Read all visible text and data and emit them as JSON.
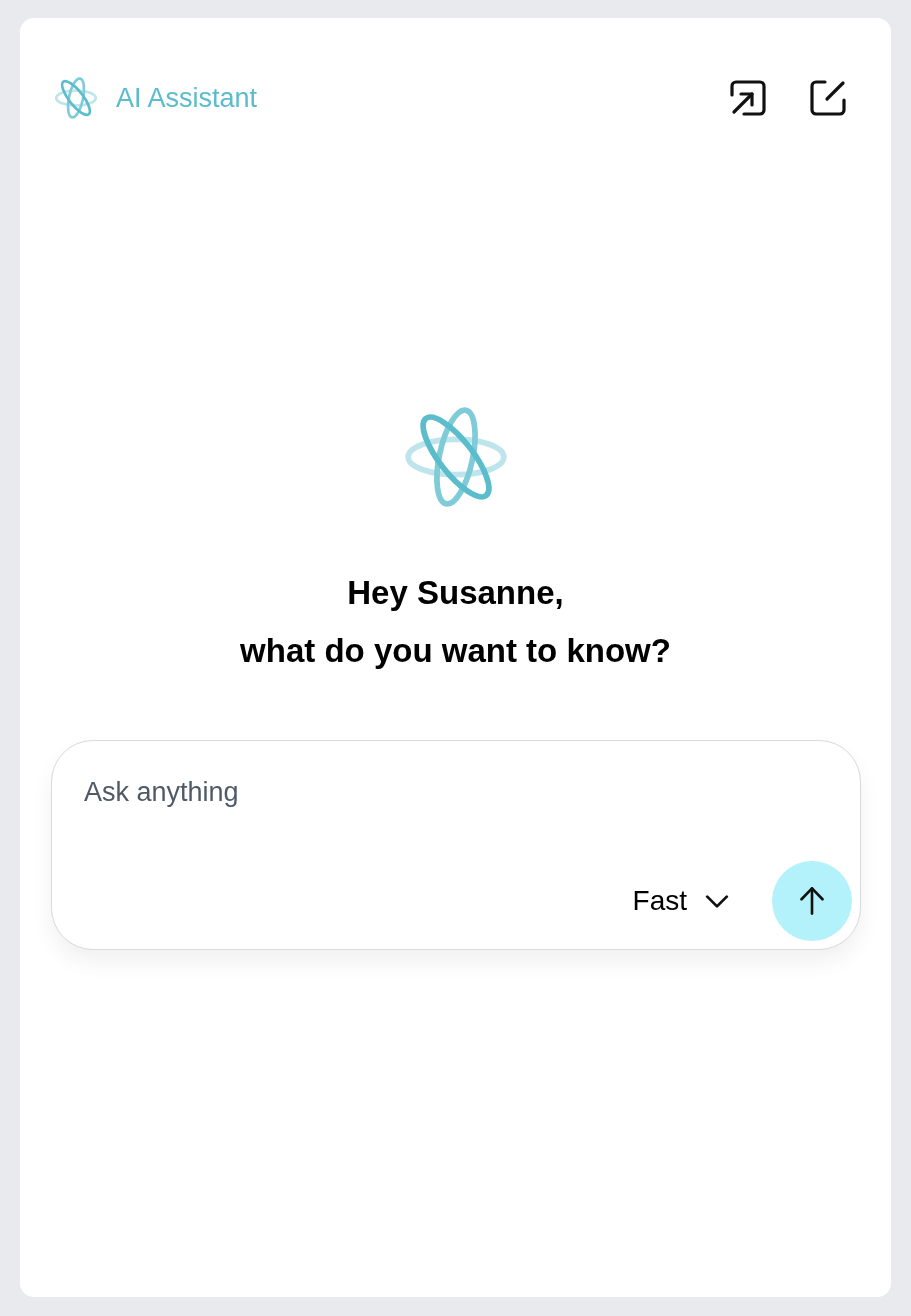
{
  "header": {
    "title": "AI Assistant"
  },
  "greeting": {
    "lines": [
      "Hey Susanne,",
      "what do you want to know?"
    ]
  },
  "composer": {
    "placeholder": "Ask anything",
    "mode": "Fast"
  }
}
